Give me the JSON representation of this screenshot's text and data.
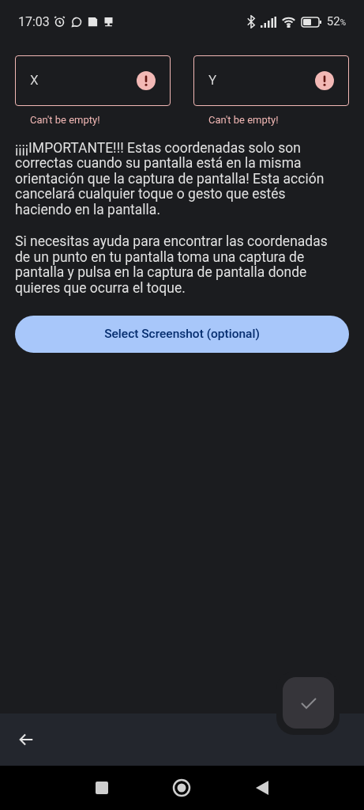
{
  "status_bar": {
    "time": "17:03",
    "battery": "52",
    "battery_unit": "%"
  },
  "fields": [
    {
      "placeholder": "X",
      "error": "Can't be empty!"
    },
    {
      "placeholder": "Y",
      "error": "Can't be empty!"
    }
  ],
  "paragraphs": [
    "¡¡¡¡IMPORTANTE!!! Estas coordenadas solo son correctas cuando su pantalla está en la misma orientación que la captura de pantalla! Esta acción cancelará cualquier toque o gesto que estés haciendo en la pantalla.",
    "Si necesitas ayuda para encontrar las coordenadas de un punto en tu pantalla toma una captura de pantalla y pulsa en la captura de pantalla donde quieres que ocurra el toque."
  ],
  "select_button": "Select Screenshot (optional)",
  "fab": {
    "disabled": true
  }
}
